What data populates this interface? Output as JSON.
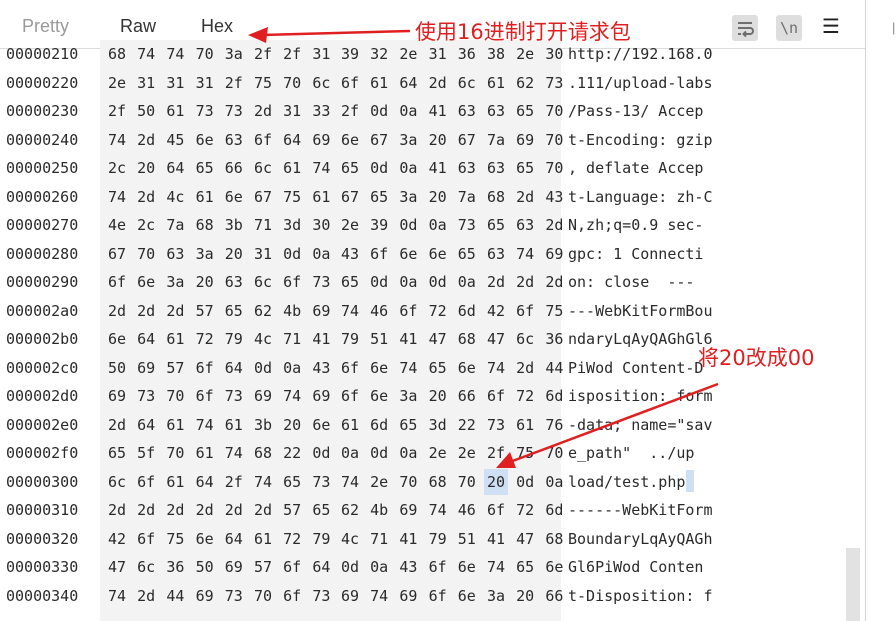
{
  "tabs": {
    "pretty": "Pretty",
    "raw": "Raw",
    "hex": "Hex",
    "active": "Hex"
  },
  "toolbar": {
    "wrap_icon": "word-wrap-icon",
    "newline_label": "\\n",
    "menu_icon": "hamburger-menu-icon",
    "menu_glyph": "☰"
  },
  "annotations": {
    "top": "使用16进制打开请求包",
    "middle": "将20改成00",
    "color": "#e02020"
  },
  "colors": {
    "accent": "#e8632b",
    "highlight": "#cfe0f5",
    "byte_bg": "#f3f3f3"
  },
  "hex_rows": [
    {
      "offset": "00000210",
      "bytes": [
        "68",
        "74",
        "74",
        "70",
        "3a",
        "2f",
        "2f",
        "31",
        "39",
        "32",
        "2e",
        "31",
        "36",
        "38",
        "2e",
        "30"
      ],
      "ascii": "http://192.168.0"
    },
    {
      "offset": "00000220",
      "bytes": [
        "2e",
        "31",
        "31",
        "31",
        "2f",
        "75",
        "70",
        "6c",
        "6f",
        "61",
        "64",
        "2d",
        "6c",
        "61",
        "62",
        "73"
      ],
      "ascii": ".111/upload-labs"
    },
    {
      "offset": "00000230",
      "bytes": [
        "2f",
        "50",
        "61",
        "73",
        "73",
        "2d",
        "31",
        "33",
        "2f",
        "0d",
        "0a",
        "41",
        "63",
        "63",
        "65",
        "70"
      ],
      "ascii": "/Pass-13/ Accep"
    },
    {
      "offset": "00000240",
      "bytes": [
        "74",
        "2d",
        "45",
        "6e",
        "63",
        "6f",
        "64",
        "69",
        "6e",
        "67",
        "3a",
        "20",
        "67",
        "7a",
        "69",
        "70"
      ],
      "ascii": "t-Encoding: gzip"
    },
    {
      "offset": "00000250",
      "bytes": [
        "2c",
        "20",
        "64",
        "65",
        "66",
        "6c",
        "61",
        "74",
        "65",
        "0d",
        "0a",
        "41",
        "63",
        "63",
        "65",
        "70"
      ],
      "ascii": ", deflate Accep"
    },
    {
      "offset": "00000260",
      "bytes": [
        "74",
        "2d",
        "4c",
        "61",
        "6e",
        "67",
        "75",
        "61",
        "67",
        "65",
        "3a",
        "20",
        "7a",
        "68",
        "2d",
        "43"
      ],
      "ascii": "t-Language: zh-C"
    },
    {
      "offset": "00000270",
      "bytes": [
        "4e",
        "2c",
        "7a",
        "68",
        "3b",
        "71",
        "3d",
        "30",
        "2e",
        "39",
        "0d",
        "0a",
        "73",
        "65",
        "63",
        "2d"
      ],
      "ascii": "N,zh;q=0.9 sec-"
    },
    {
      "offset": "00000280",
      "bytes": [
        "67",
        "70",
        "63",
        "3a",
        "20",
        "31",
        "0d",
        "0a",
        "43",
        "6f",
        "6e",
        "6e",
        "65",
        "63",
        "74",
        "69"
      ],
      "ascii": "gpc: 1 Connecti"
    },
    {
      "offset": "00000290",
      "bytes": [
        "6f",
        "6e",
        "3a",
        "20",
        "63",
        "6c",
        "6f",
        "73",
        "65",
        "0d",
        "0a",
        "0d",
        "0a",
        "2d",
        "2d",
        "2d"
      ],
      "ascii": "on: close  ---"
    },
    {
      "offset": "000002a0",
      "bytes": [
        "2d",
        "2d",
        "2d",
        "57",
        "65",
        "62",
        "4b",
        "69",
        "74",
        "46",
        "6f",
        "72",
        "6d",
        "42",
        "6f",
        "75"
      ],
      "ascii": "---WebKitFormBou"
    },
    {
      "offset": "000002b0",
      "bytes": [
        "6e",
        "64",
        "61",
        "72",
        "79",
        "4c",
        "71",
        "41",
        "79",
        "51",
        "41",
        "47",
        "68",
        "47",
        "6c",
        "36"
      ],
      "ascii": "ndaryLqAyQAGhGl6"
    },
    {
      "offset": "000002c0",
      "bytes": [
        "50",
        "69",
        "57",
        "6f",
        "64",
        "0d",
        "0a",
        "43",
        "6f",
        "6e",
        "74",
        "65",
        "6e",
        "74",
        "2d",
        "44"
      ],
      "ascii": "PiWod Content-D"
    },
    {
      "offset": "000002d0",
      "bytes": [
        "69",
        "73",
        "70",
        "6f",
        "73",
        "69",
        "74",
        "69",
        "6f",
        "6e",
        "3a",
        "20",
        "66",
        "6f",
        "72",
        "6d"
      ],
      "ascii": "isposition: form"
    },
    {
      "offset": "000002e0",
      "bytes": [
        "2d",
        "64",
        "61",
        "74",
        "61",
        "3b",
        "20",
        "6e",
        "61",
        "6d",
        "65",
        "3d",
        "22",
        "73",
        "61",
        "76"
      ],
      "ascii": "-data; name=\"sav"
    },
    {
      "offset": "000002f0",
      "bytes": [
        "65",
        "5f",
        "70",
        "61",
        "74",
        "68",
        "22",
        "0d",
        "0a",
        "0d",
        "0a",
        "2e",
        "2e",
        "2f",
        "75",
        "70"
      ],
      "ascii": "e_path\"  ../up"
    },
    {
      "offset": "00000300",
      "bytes": [
        "6c",
        "6f",
        "61",
        "64",
        "2f",
        "74",
        "65",
        "73",
        "74",
        "2e",
        "70",
        "68",
        "70",
        "20",
        "0d",
        "0a"
      ],
      "ascii": "load/test.php",
      "highlight": 13
    },
    {
      "offset": "00000310",
      "bytes": [
        "2d",
        "2d",
        "2d",
        "2d",
        "2d",
        "2d",
        "57",
        "65",
        "62",
        "4b",
        "69",
        "74",
        "46",
        "6f",
        "72",
        "6d"
      ],
      "ascii": "------WebKitForm"
    },
    {
      "offset": "00000320",
      "bytes": [
        "42",
        "6f",
        "75",
        "6e",
        "64",
        "61",
        "72",
        "79",
        "4c",
        "71",
        "41",
        "79",
        "51",
        "41",
        "47",
        "68"
      ],
      "ascii": "BoundaryLqAyQAGh"
    },
    {
      "offset": "00000330",
      "bytes": [
        "47",
        "6c",
        "36",
        "50",
        "69",
        "57",
        "6f",
        "64",
        "0d",
        "0a",
        "43",
        "6f",
        "6e",
        "74",
        "65",
        "6e"
      ],
      "ascii": "Gl6PiWod Conten"
    },
    {
      "offset": "00000340",
      "bytes": [
        "74",
        "2d",
        "44",
        "69",
        "73",
        "70",
        "6f",
        "73",
        "69",
        "74",
        "69",
        "6f",
        "6e",
        "3a",
        "20",
        "66"
      ],
      "ascii": "t-Disposition: f"
    }
  ]
}
